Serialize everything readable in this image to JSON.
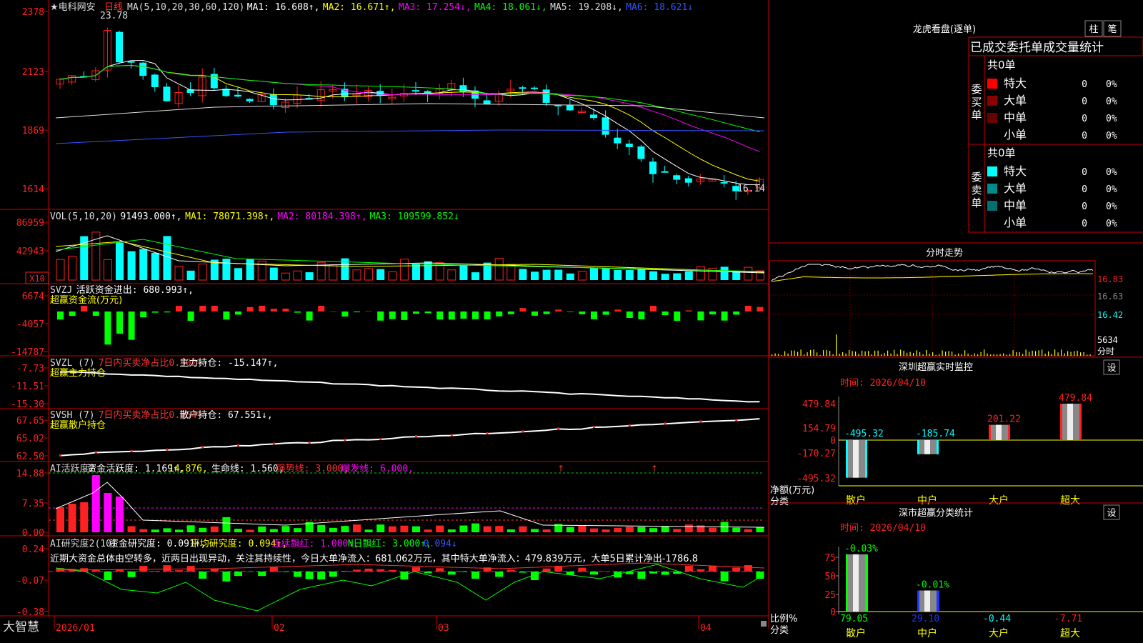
{
  "stock": {
    "title": "★电科网安",
    "period": "日线"
  },
  "axis": {
    "price": [
      "2378",
      "2123",
      "1869",
      "1614"
    ],
    "vol": [
      "86959",
      "42943"
    ],
    "vol_unit": "X10",
    "svzj": [
      "6674",
      "-4057",
      "-14787"
    ],
    "svzl": [
      "-7.73",
      "-11.51",
      "-15.30"
    ],
    "svsh": [
      "67.65",
      "65.02",
      "62.50"
    ],
    "aihy": [
      "14.88",
      "7.35",
      "0.00"
    ],
    "aiyj": [
      "0.24",
      "-0.07",
      "-0.38"
    ],
    "dates": [
      "2026/01",
      "02",
      "03",
      "04"
    ]
  },
  "price_panel": {
    "hi_label": "23.78",
    "lo_label": "16.14",
    "legend": [
      {
        "text": "MA(5,10,20,30,60,120)",
        "color": "#dddddd"
      },
      {
        "text": "MA1: 16.608↑,",
        "color": "#ffffff"
      },
      {
        "text": "MA2: 16.671↑,",
        "color": "#ffff00"
      },
      {
        "text": "MA3: 17.254↓,",
        "color": "#ff00ff"
      },
      {
        "text": "MA4: 18.061↓,",
        "color": "#00ff00"
      },
      {
        "text": "MA5: 19.208↓,",
        "color": "#dddddd"
      },
      {
        "text": "MA6: 18.621↓",
        "color": "#3355ff"
      }
    ]
  },
  "vol_panel": {
    "legend": [
      {
        "text": "VOL(5,10,20)",
        "color": "#dddddd"
      },
      {
        "text": "91493.000↑,",
        "color": "#ffffff"
      },
      {
        "text": "MA1: 78071.398↑,",
        "color": "#ffff00"
      },
      {
        "text": "MA2: 80184.398↑,",
        "color": "#ff00ff"
      },
      {
        "text": "MA3: 109599.852↓",
        "color": "#00ff00"
      }
    ]
  },
  "svzj_panel": {
    "legend": [
      {
        "text": "SVZJ",
        "color": "#dddddd"
      },
      {
        "text": "活跃资金进出: 680.993↑,",
        "color": "#ffffff"
      }
    ],
    "sub": "超赢资金流(万元)"
  },
  "svzl_panel": {
    "legend": [
      {
        "text": "SVZL (7)",
        "color": "#dddddd"
      },
      {
        "text": "7日内买卖净占比0.502%",
        "color": "#ff3333"
      },
      {
        "text": "主力持仓: -15.147↑,",
        "color": "#ffffff"
      }
    ],
    "sub": "超赢主力持仓"
  },
  "svsh_panel": {
    "legend": [
      {
        "text": "SVSH (7)",
        "color": "#dddddd"
      },
      {
        "text": "7日内买卖净占比0.554%",
        "color": "#ff3333"
      },
      {
        "text": "散户持仓: 67.551↓,",
        "color": "#ffffff"
      }
    ],
    "sub": "超赢散户持仓"
  },
  "aihy_panel": {
    "legend": [
      {
        "text": "AI活跃度2",
        "color": "#dddddd"
      },
      {
        "text": "资金活跃度: 1.169↑,",
        "color": "#ffffff"
      },
      {
        "text": "14.876,",
        "color": "#ffff00"
      },
      {
        "text": "生命线: 1.560,",
        "color": "#ffffff"
      },
      {
        "text": "强势线: 3.000,",
        "color": "#ff3333"
      },
      {
        "text": "爆发线: 6.000,",
        "color": "#ff00ff"
      }
    ]
  },
  "aiyj_panel": {
    "legend": [
      {
        "text": "AI研究度2(10)",
        "color": "#dddddd"
      },
      {
        "text": "资金研究度: 0.091↑,",
        "color": "#ffffff"
      },
      {
        "text": "平均研究度: 0.094↑,",
        "color": "#ffff00"
      },
      {
        "text": "连续飘红: 1.000↑,",
        "color": "#ff00ff"
      },
      {
        "text": "N日飘红: 3.000↑,",
        "color": "#00ff00"
      },
      {
        "text": "0.094↓",
        "color": "#3355ff"
      }
    ],
    "comment": "近期大资金总体由空转多，近两日出现异动，关注其持续性，今日大单净流入：681.062万元，其中特大单净流入：479.839万元，大单5日累计净出-1786.8"
  },
  "brand": "大智慧",
  "lhkp": {
    "title": "龙虎看盘(逐单)",
    "btn_bar": "柱",
    "btn_pen": "笔",
    "header": "已成交委托单成交量统计",
    "buy": {
      "side": "委买单",
      "total": "共0单",
      "rows": [
        {
          "label": "特大",
          "val": "0",
          "pct": "0%",
          "color": "#ff0000"
        },
        {
          "label": "大单",
          "val": "0",
          "pct": "0%",
          "color": "#8b0000"
        },
        {
          "label": "中单",
          "val": "0",
          "pct": "0%",
          "color": "#6b0000"
        },
        {
          "label": "小单",
          "val": "0",
          "pct": "0%",
          "color": ""
        }
      ]
    },
    "sell": {
      "side": "委卖单",
      "total": "共0单",
      "rows": [
        {
          "label": "特大",
          "val": "0",
          "pct": "0%",
          "color": "#00ffff"
        },
        {
          "label": "大单",
          "val": "0",
          "pct": "0%",
          "color": "#008b8b"
        },
        {
          "label": "中单",
          "val": "0",
          "pct": "0%",
          "color": "#007070"
        },
        {
          "label": "小单",
          "val": "0",
          "pct": "0%",
          "color": ""
        }
      ]
    }
  },
  "intraday": {
    "title": "分时走势",
    "prices": [
      "16.83",
      "16.63",
      "16.42"
    ],
    "vol": "5634",
    "unit": "分时"
  },
  "sz_monitor": {
    "title": "深圳超赢实时监控",
    "setting": "设",
    "time": "时间: 2026/04/10",
    "yaxis": [
      "479.84",
      "154.79",
      "0",
      "-170.27",
      "-495.32"
    ],
    "ylabel": "净额(万元)",
    "xlabel": "分类",
    "cats": [
      "散户",
      "中户",
      "大户",
      "超大"
    ],
    "values": [
      -495.32,
      -185.74,
      201.22,
      479.84
    ],
    "value_labels": [
      "-495.32",
      "-185.74",
      "201.22",
      "479.84"
    ]
  },
  "sz_class": {
    "title": "深市超赢分类统计",
    "setting": "设",
    "time": "时间: 2026/04/10",
    "yaxis": [
      "75",
      "50",
      "25",
      "0"
    ],
    "ylabel": "比例%",
    "xlabel": "分类",
    "cats": [
      "散户",
      "中户",
      "大户",
      "超大"
    ],
    "values": [
      79.05,
      29.1,
      -0.44,
      -7.71
    ],
    "value_labels": [
      "79.05",
      "29.10",
      "-0.44",
      "-7.71"
    ],
    "top_labels": [
      "-0.03%",
      "-0.01%",
      "",
      ""
    ]
  }
}
